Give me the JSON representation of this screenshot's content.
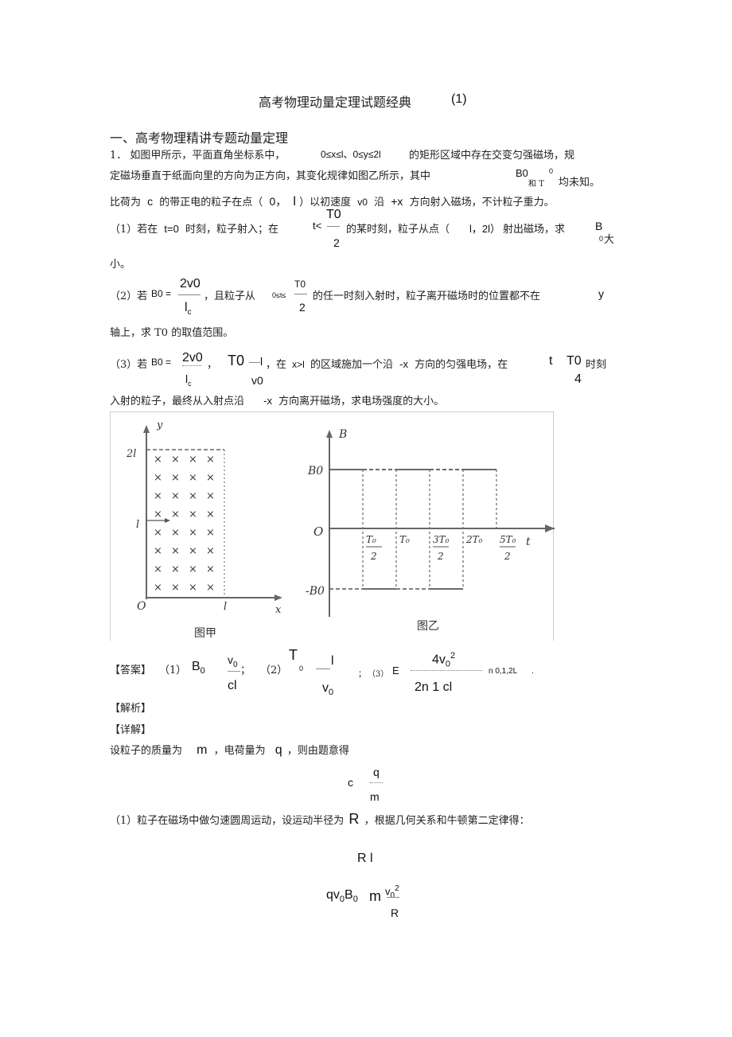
{
  "doc": {
    "title": "高考物理动量定理试题经典",
    "title_suffix": "(1)",
    "section_heading": "一、高考物理精讲专题动量定理"
  },
  "problem": {
    "line1": {
      "prefix": "1．  如图甲所示，平面直角坐标系中，",
      "range": "0≤x≤l、0≤y≤2l",
      "suffix": "的矩形区域中存在交变匀强磁场，规"
    },
    "line2": {
      "text": "定磁场垂直于纸面向里的方向为正方向，其变化规律如图乙所示，其中",
      "b0": "B0",
      "and_t": "和 T",
      "zero": "0",
      "tail": "均未知。"
    },
    "line3": {
      "a": "比荷为",
      "c": "c",
      "b": "的带正电的粒子在点（",
      "pt": "0，",
      "l": "l",
      "d": "）以初速度",
      "v0": "v0",
      "e": "沿",
      "px": "+x",
      "f": "方向射入磁场，不计粒子重力。"
    },
    "q1": {
      "label": "（1）若在",
      "t0": "t=0",
      "a": "时刻，粒子射入；在",
      "tlt": "t<",
      "num": "T0",
      "den": "2",
      "b": "的某时刻，粒子从点（",
      "pt": "l，2l）",
      "c": "射出磁场，求",
      "B": "B",
      "sub0": "0",
      "da": "大",
      "xiao": "小。"
    },
    "q2": {
      "label": "（2）若",
      "b0eq": "B0 =",
      "num": "2v0",
      "den": "lc",
      "a": "，且粒子从",
      "range": "0≤t≤",
      "tnum": "T0",
      "tden": "2",
      "b": "的任一时刻入射时，粒子离开磁场时的位置都不在",
      "y": "y",
      "line2": "轴上，求  T0 的取值范围。"
    },
    "q3": {
      "label": "（3）若",
      "b0eq": "B0 =",
      "num": "2v0",
      "den": "lc",
      "comma": "，",
      "T0": "T0",
      "tnum": "l",
      "tden": "v0",
      "a": "，在",
      "xgl": "x>l",
      "b": "的区域施加一个沿",
      "mx": "-x",
      "c": "方向的匀强电场，在",
      "t": "t",
      "T": "T0",
      "four": "4",
      "d": "时刻",
      "line2a": "入射的粒子，最终从入射点沿",
      "line2b": "-x",
      "line2c": "方向离开磁场，求电场强度的大小。"
    }
  },
  "figures": {
    "fig_a": {
      "caption": "图甲",
      "y_label": "y",
      "x_label": "x",
      "origin": "O",
      "y_tick_2l": "2l",
      "y_tick_l": "l",
      "x_tick_l": "l",
      "field_symbol": "×",
      "field_rows": 8,
      "field_cols": 4
    },
    "fig_b": {
      "caption": "图乙",
      "y_label": "B",
      "x_label": "t",
      "origin": "O",
      "pos_level": "B0",
      "neg_level": "-B0",
      "t_ticks": [
        "T0/2",
        "T0",
        "3T0/2",
        "2T0",
        "5T0/2"
      ],
      "waveform": [
        {
          "from": 0,
          "to": 0.5,
          "level": 1
        },
        {
          "from": 0.5,
          "to": 1,
          "level": 1
        },
        {
          "from": 1,
          "to": 1.5,
          "level": 1
        },
        {
          "from": 1.5,
          "to": 2,
          "level": 1
        },
        {
          "from": 2,
          "to": 2.5,
          "level": 1
        }
      ],
      "neg_segments": [
        {
          "from": 0.5,
          "to": 1.0
        },
        {
          "from": 1.5,
          "to": 2.0
        }
      ]
    }
  },
  "answer": {
    "tag": "【答案】",
    "p1": "（1）",
    "B0": "B0",
    "a1_num": "v0",
    "a1_den": "cl",
    "semi": "；",
    "p2": "（2）",
    "T": "T",
    "sub0": "0",
    "a2_num": "l",
    "a2_den": "v0",
    "semi2": "；",
    "p3": "（3）",
    "E": "E",
    "a3_num": "4v0²",
    "a3_den": "2n  1   cl",
    "n_range": "n  0,1,2L",
    "period": "."
  },
  "analysis": {
    "tag": "【解析】",
    "detail_tag": "【详解】",
    "line1a": "设粒子的质量为",
    "m": "m",
    "line1b": "，电荷量为",
    "q": "q",
    "line1c": "，则由题意得",
    "eq1_lhs": "c",
    "eq1_num": "q",
    "eq1_den": "m",
    "line2a": "（1）粒子在磁场中做匀速圆周运动，设运动半径为",
    "R": "R",
    "line2b": "，根据几何关系和牛顿第二定律得：",
    "eq2": "R l",
    "eq3_lhs": "qv0B0",
    "eq3_m": "m",
    "eq3_num": "v0²",
    "eq3_den": "R"
  }
}
